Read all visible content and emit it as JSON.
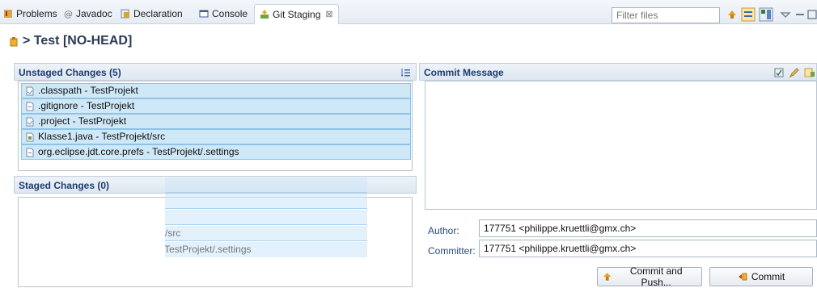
{
  "tabs": [
    {
      "label": "Problems",
      "icon": "problems-icon"
    },
    {
      "label": "Javadoc",
      "icon": "javadoc-icon"
    },
    {
      "label": "Declaration",
      "icon": "declaration-icon"
    },
    {
      "label": "Console",
      "icon": "console-icon"
    },
    {
      "label": "Git Staging",
      "icon": "git-staging-icon",
      "close": "⊠"
    }
  ],
  "toolbar": {
    "filter_placeholder": "Filter files"
  },
  "repo": {
    "title": "> Test [NO-HEAD]"
  },
  "unstaged": {
    "header": "Unstaged Changes (5)",
    "files": [
      ".classpath - TestProjekt",
      ".gitignore - TestProjekt",
      ".project - TestProjekt",
      "Klasse1.java - TestProjekt/src",
      "org.eclipse.jdt.core.prefs - TestProjekt/.settings"
    ]
  },
  "staged": {
    "header": "Staged Changes (0)",
    "drag_ghost": [
      "/src",
      "- TestProjekt/.settings"
    ]
  },
  "commit": {
    "header": "Commit Message",
    "author_label": "Author:",
    "author_value": "177751 <philippe.kruettli@gmx.ch>",
    "committer_label": "Committer:",
    "committer_value": "177751 <philippe.kruettli@gmx.ch>",
    "commit_push_label": "Commit and Push...",
    "commit_label": "Commit"
  },
  "colors": {
    "selection": "#cfe8f8",
    "header_text": "#1d3d6e",
    "accent": "#e8a020"
  }
}
